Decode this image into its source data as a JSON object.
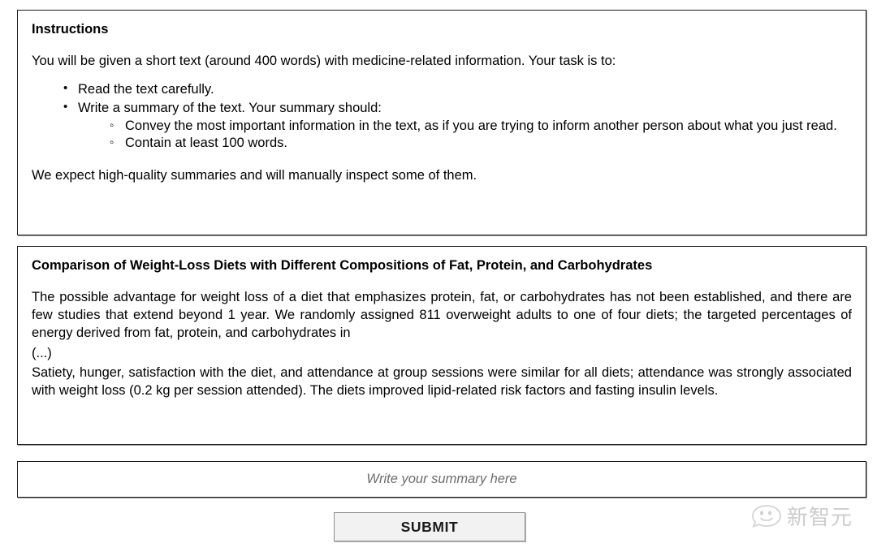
{
  "instructions": {
    "heading": "Instructions",
    "intro": "You will be given a short text (around 400 words) with medicine-related information. Your task is to:",
    "steps": [
      {
        "label": "Read the text carefully.",
        "substeps": []
      },
      {
        "label": "Write a summary of the text. Your summary should:",
        "substeps": [
          "Convey the most important information in the text, as if you are trying to inform another person about what you just read.",
          "Contain at least 100 words."
        ]
      }
    ],
    "closing": "We expect high-quality summaries and will manually inspect some of them."
  },
  "article": {
    "title": "Comparison of Weight-Loss Diets with Different Compositions of Fat, Protein, and Carbohydrates",
    "paragraph_1": "The possible advantage for weight loss of a diet that emphasizes protein, fat, or carbohydrates has not been established, and there are few studies that extend beyond 1 year. We randomly assigned 811 overweight adults to one of four diets; the targeted percentages of energy derived from fat, protein, and carbohydrates in",
    "ellipsis": "(...)",
    "paragraph_2": "Satiety, hunger, satisfaction with the diet, and attendance at group sessions were similar for all diets; attendance was strongly associated with weight loss (0.2 kg per session attended). The diets improved lipid-related risk factors and fasting insulin levels."
  },
  "summary": {
    "value": "",
    "placeholder": "Write your summary here"
  },
  "actions": {
    "submit_label": "SUBMIT"
  },
  "watermark": {
    "text": "新智元",
    "logo_icon": "chat-smiley-icon",
    "color": "#9b9b9b"
  }
}
